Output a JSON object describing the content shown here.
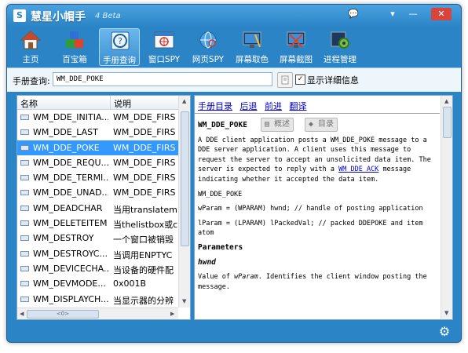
{
  "app": {
    "title": "慧星小帽手",
    "version": "4 Beta",
    "logo": "S"
  },
  "window_controls": {
    "chat": "💬",
    "menu": "▾",
    "minimize": "—",
    "close": "✕"
  },
  "toolbar": [
    {
      "label": "主页",
      "icon": "home-icon"
    },
    {
      "label": "百宝箱",
      "icon": "cubes-icon"
    },
    {
      "label": "手册查询",
      "icon": "help-manual-icon"
    },
    {
      "label": "窗口SPY",
      "icon": "window-spy-icon"
    },
    {
      "label": "网页SPY",
      "icon": "web-spy-icon"
    },
    {
      "label": "屏幕取色",
      "icon": "color-picker-icon"
    },
    {
      "label": "屏幕截图",
      "icon": "screenshot-icon"
    },
    {
      "label": "进程管理",
      "icon": "process-gear-icon"
    }
  ],
  "search": {
    "label": "手册查询:",
    "value": "WM_DDE_POKE",
    "button_icon": "search-icon",
    "checkbox_checked": true,
    "checkbox_mark": "✓",
    "checkbox_label": "显示详细信息"
  },
  "list": {
    "headers": [
      "名称",
      "说明"
    ],
    "rows": [
      {
        "name": "WM_DDE_INITIA...",
        "desc": "WM_DDE_FIRS"
      },
      {
        "name": "WM_DDE_LAST",
        "desc": "WM_DDE_FIRS"
      },
      {
        "name": "WM_DDE_POKE",
        "desc": "WM_DDE_FIRS",
        "selected": true
      },
      {
        "name": "WM_DDE_REQU...",
        "desc": "WM_DDE_FIRS"
      },
      {
        "name": "WM_DDE_TERMI...",
        "desc": "WM_DDE_FIRS"
      },
      {
        "name": "WM_DDE_UNAD...",
        "desc": "WM_DDE_FIRS"
      },
      {
        "name": "WM_DEADCHAR",
        "desc": "当用translatem"
      },
      {
        "name": "WM_DELETEITEM",
        "desc": "当thelistbox或c"
      },
      {
        "name": "WM_DESTROY",
        "desc": "一个窗口被销毁"
      },
      {
        "name": "WM_DESTROYC...",
        "desc": "当调用ENPTYC"
      },
      {
        "name": "WM_DEVICECHA...",
        "desc": "当设备的硬件配"
      },
      {
        "name": "WM_DEVMODE...",
        "desc": "0x001B"
      },
      {
        "name": "WM_DISPLAYCH...",
        "desc": "当显示器的分辨"
      }
    ],
    "hscroll_label": "<0>"
  },
  "doc": {
    "links": [
      "手册目录",
      "后退",
      "前进",
      "翻译"
    ],
    "title": "WM_DDE_POKE",
    "overview_button": "概述",
    "contents_button": "目录",
    "intro_before_link": "A DDE client application posts a WM_DDE_POKE message to a DDE server application. A client uses this message to request the server to accept an unsolicited data item. The server is expected to reply with a",
    "link_text": "WM_DDE_ACK",
    "intro_after_link": "message indicating whether it accepted the data item.",
    "syntax_name": "WM_DDE_POKE",
    "syntax_wparam": "wParam = (WPARAM) hwnd; // handle of posting application",
    "syntax_lparam": "lParam = (LPARAM) lPackedVal; // packed DDEPOKE and item atom",
    "params_heading": "Parameters",
    "param_name": "hwnd",
    "param_desc_prefix": "Value of ",
    "param_desc_ital": "wParam",
    "param_desc_suffix": ". Identifies the client window posting the message."
  },
  "status": {
    "gear_icon": "⚙"
  }
}
